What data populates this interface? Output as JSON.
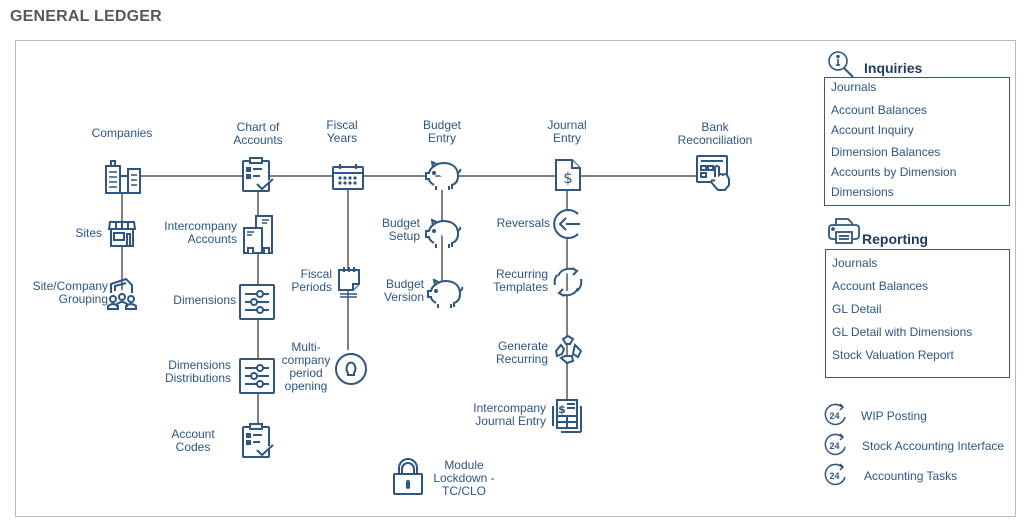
{
  "page": {
    "title": "GENERAL LEDGER"
  },
  "colors": {
    "icon": "#2e5680",
    "connector": "#808080",
    "panel_border": "#3d5877",
    "frame_border": "#b9b9b9"
  },
  "flow": {
    "companies": {
      "label": "Companies",
      "icon": "buildings-icon"
    },
    "sites": {
      "label": "Sites",
      "icon": "storefront-icon"
    },
    "site_company_grouping": {
      "label": "Site/Company\nGrouping",
      "icon": "group-people-icon"
    },
    "chart_of_accounts": {
      "label": "Chart of\nAccounts",
      "icon": "clipboard-check-icon"
    },
    "intercompany_accounts": {
      "label": "Intercompany\nAccounts",
      "icon": "office-buildings-icon"
    },
    "dimensions": {
      "label": "Dimensions",
      "icon": "sliders-icon"
    },
    "dimensions_distributions": {
      "label": "Dimensions\nDistributions",
      "icon": "sliders-icon"
    },
    "account_codes": {
      "label": "Account\nCodes",
      "icon": "clipboard-check-icon"
    },
    "fiscal_years": {
      "label": "Fiscal\nYears",
      "icon": "calendar-icon"
    },
    "fiscal_periods": {
      "label": "Fiscal\nPeriods",
      "icon": "calendar-page-icon"
    },
    "multi_company_period_opening": {
      "label": "Multi-\ncompany\nperiod\nopening",
      "icon": "keyhole-icon"
    },
    "budget_entry": {
      "label": "Budget\nEntry",
      "icon": "piggy-bank-icon"
    },
    "budget_setup": {
      "label": "Budget\nSetup",
      "icon": "piggy-bank-icon"
    },
    "budget_version": {
      "label": "Budget\nVersion",
      "icon": "piggy-bank-icon"
    },
    "journal_entry": {
      "label": "Journal\nEntry",
      "icon": "dollar-document-icon"
    },
    "reversals": {
      "label": "Reversals",
      "icon": "reverse-arrow-icon"
    },
    "recurring_templates": {
      "label": "Recurring\nTemplates",
      "icon": "refresh-icon"
    },
    "generate_recurring": {
      "label": "Generate\nRecurring",
      "icon": "recycle-icon"
    },
    "intercompany_journal_entry": {
      "label": "Intercompany\nJournal Entry",
      "icon": "dollar-ledger-icon"
    },
    "bank_reconciliation": {
      "label": "Bank\nReconciliation",
      "icon": "touch-terminal-icon"
    },
    "module_lockdown": {
      "label": "Module\nLockdown -\nTC/CLO",
      "icon": "padlock-icon"
    }
  },
  "inquiries": {
    "title": "Inquiries",
    "items": [
      "Journals",
      "Account Balances",
      "Account Inquiry",
      "Dimension Balances",
      "Accounts by Dimension",
      "Dimensions"
    ]
  },
  "reporting": {
    "title": "Reporting",
    "items": [
      "Journals",
      "Account Balances",
      "GL Detail",
      "GL Detail with Dimensions",
      "Stock Valuation Report"
    ]
  },
  "tasks": [
    {
      "label": "WIP Posting",
      "badge": "24"
    },
    {
      "label": "Stock Accounting Interface",
      "badge": "24"
    },
    {
      "label": "Accounting Tasks",
      "badge": "24"
    }
  ]
}
